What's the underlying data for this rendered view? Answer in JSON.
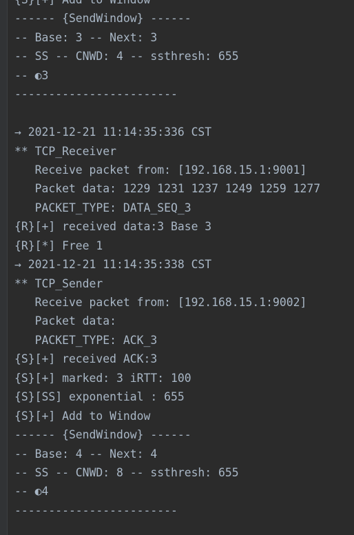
{
  "colors": {
    "background": "#2b2b2b",
    "gutter": "#313335",
    "text": "#a9b7c6"
  },
  "console": {
    "lines": [
      "{S}[+] Add to Window",
      "------ {SendWindow} ------",
      "-- Base: 3 -- Next: 3",
      "-- SS -- CNWD: 4 -- ssthresh: 655",
      "-- ◐3",
      "------------------------",
      "",
      "→ 2021-12-21 11:14:35:336 CST",
      "** TCP_Receiver",
      "   Receive packet from: [192.168.15.1:9001]",
      "   Packet data: 1229 1231 1237 1249 1259 1277",
      "   PACKET_TYPE: DATA_SEQ_3",
      "{R}[+] received data:3 Base 3",
      "{R}[*] Free 1",
      "→ 2021-12-21 11:14:35:338 CST",
      "** TCP_Sender",
      "   Receive packet from: [192.168.15.1:9002]",
      "   Packet data:",
      "   PACKET_TYPE: ACK_3",
      "{S}[+] received ACK:3",
      "{S}[+] marked: 3 iRTT: 100",
      "{S}[SS] exponential : 655",
      "{S}[+] Add to Window",
      "------ {SendWindow} ------",
      "-- Base: 4 -- Next: 4",
      "-- SS -- CNWD: 8 -- ssthresh: 655",
      "-- ◐4",
      "------------------------"
    ]
  }
}
